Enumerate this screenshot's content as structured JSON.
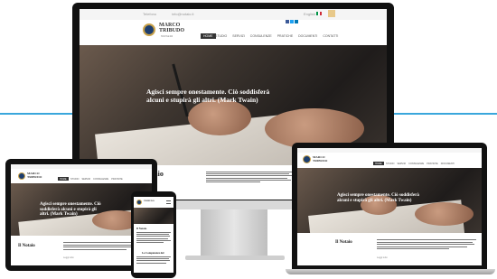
{
  "brand": {
    "name_line1": "MARCO",
    "name_line2": "TRIBUDO",
    "tagline": "NOTAIO"
  },
  "top_bar": {
    "phone": "Telefono",
    "email": "info@notaio.it",
    "lang": "English"
  },
  "nav": {
    "home": "HOME",
    "items": [
      "STUDIO",
      "SERVIZI",
      "CONSULENZE",
      "PRATICHE",
      "DOCUMENTI",
      "CONTATTI"
    ]
  },
  "hero": {
    "quote": "Agisci sempre onestamente. Ciò soddisferà alcuni e stupirà gli altri. (Mark Twain)",
    "quote_short": "Agisci sempre onestamente. Ciò soddisferà alcuni e stupirà gli altri. (Mark Twain)"
  },
  "section": {
    "title": "Il Notaio",
    "title_partial": "taio",
    "more": "Leggi tutto"
  },
  "phone_screen": {
    "title": "Il Notaio",
    "subtitle": "Le Competenze del"
  },
  "colors": {
    "accent_blue": "#2aa6dc",
    "nav_dark": "#333333",
    "hero_dark": "#2b2522",
    "gold": "#c9a24a"
  }
}
